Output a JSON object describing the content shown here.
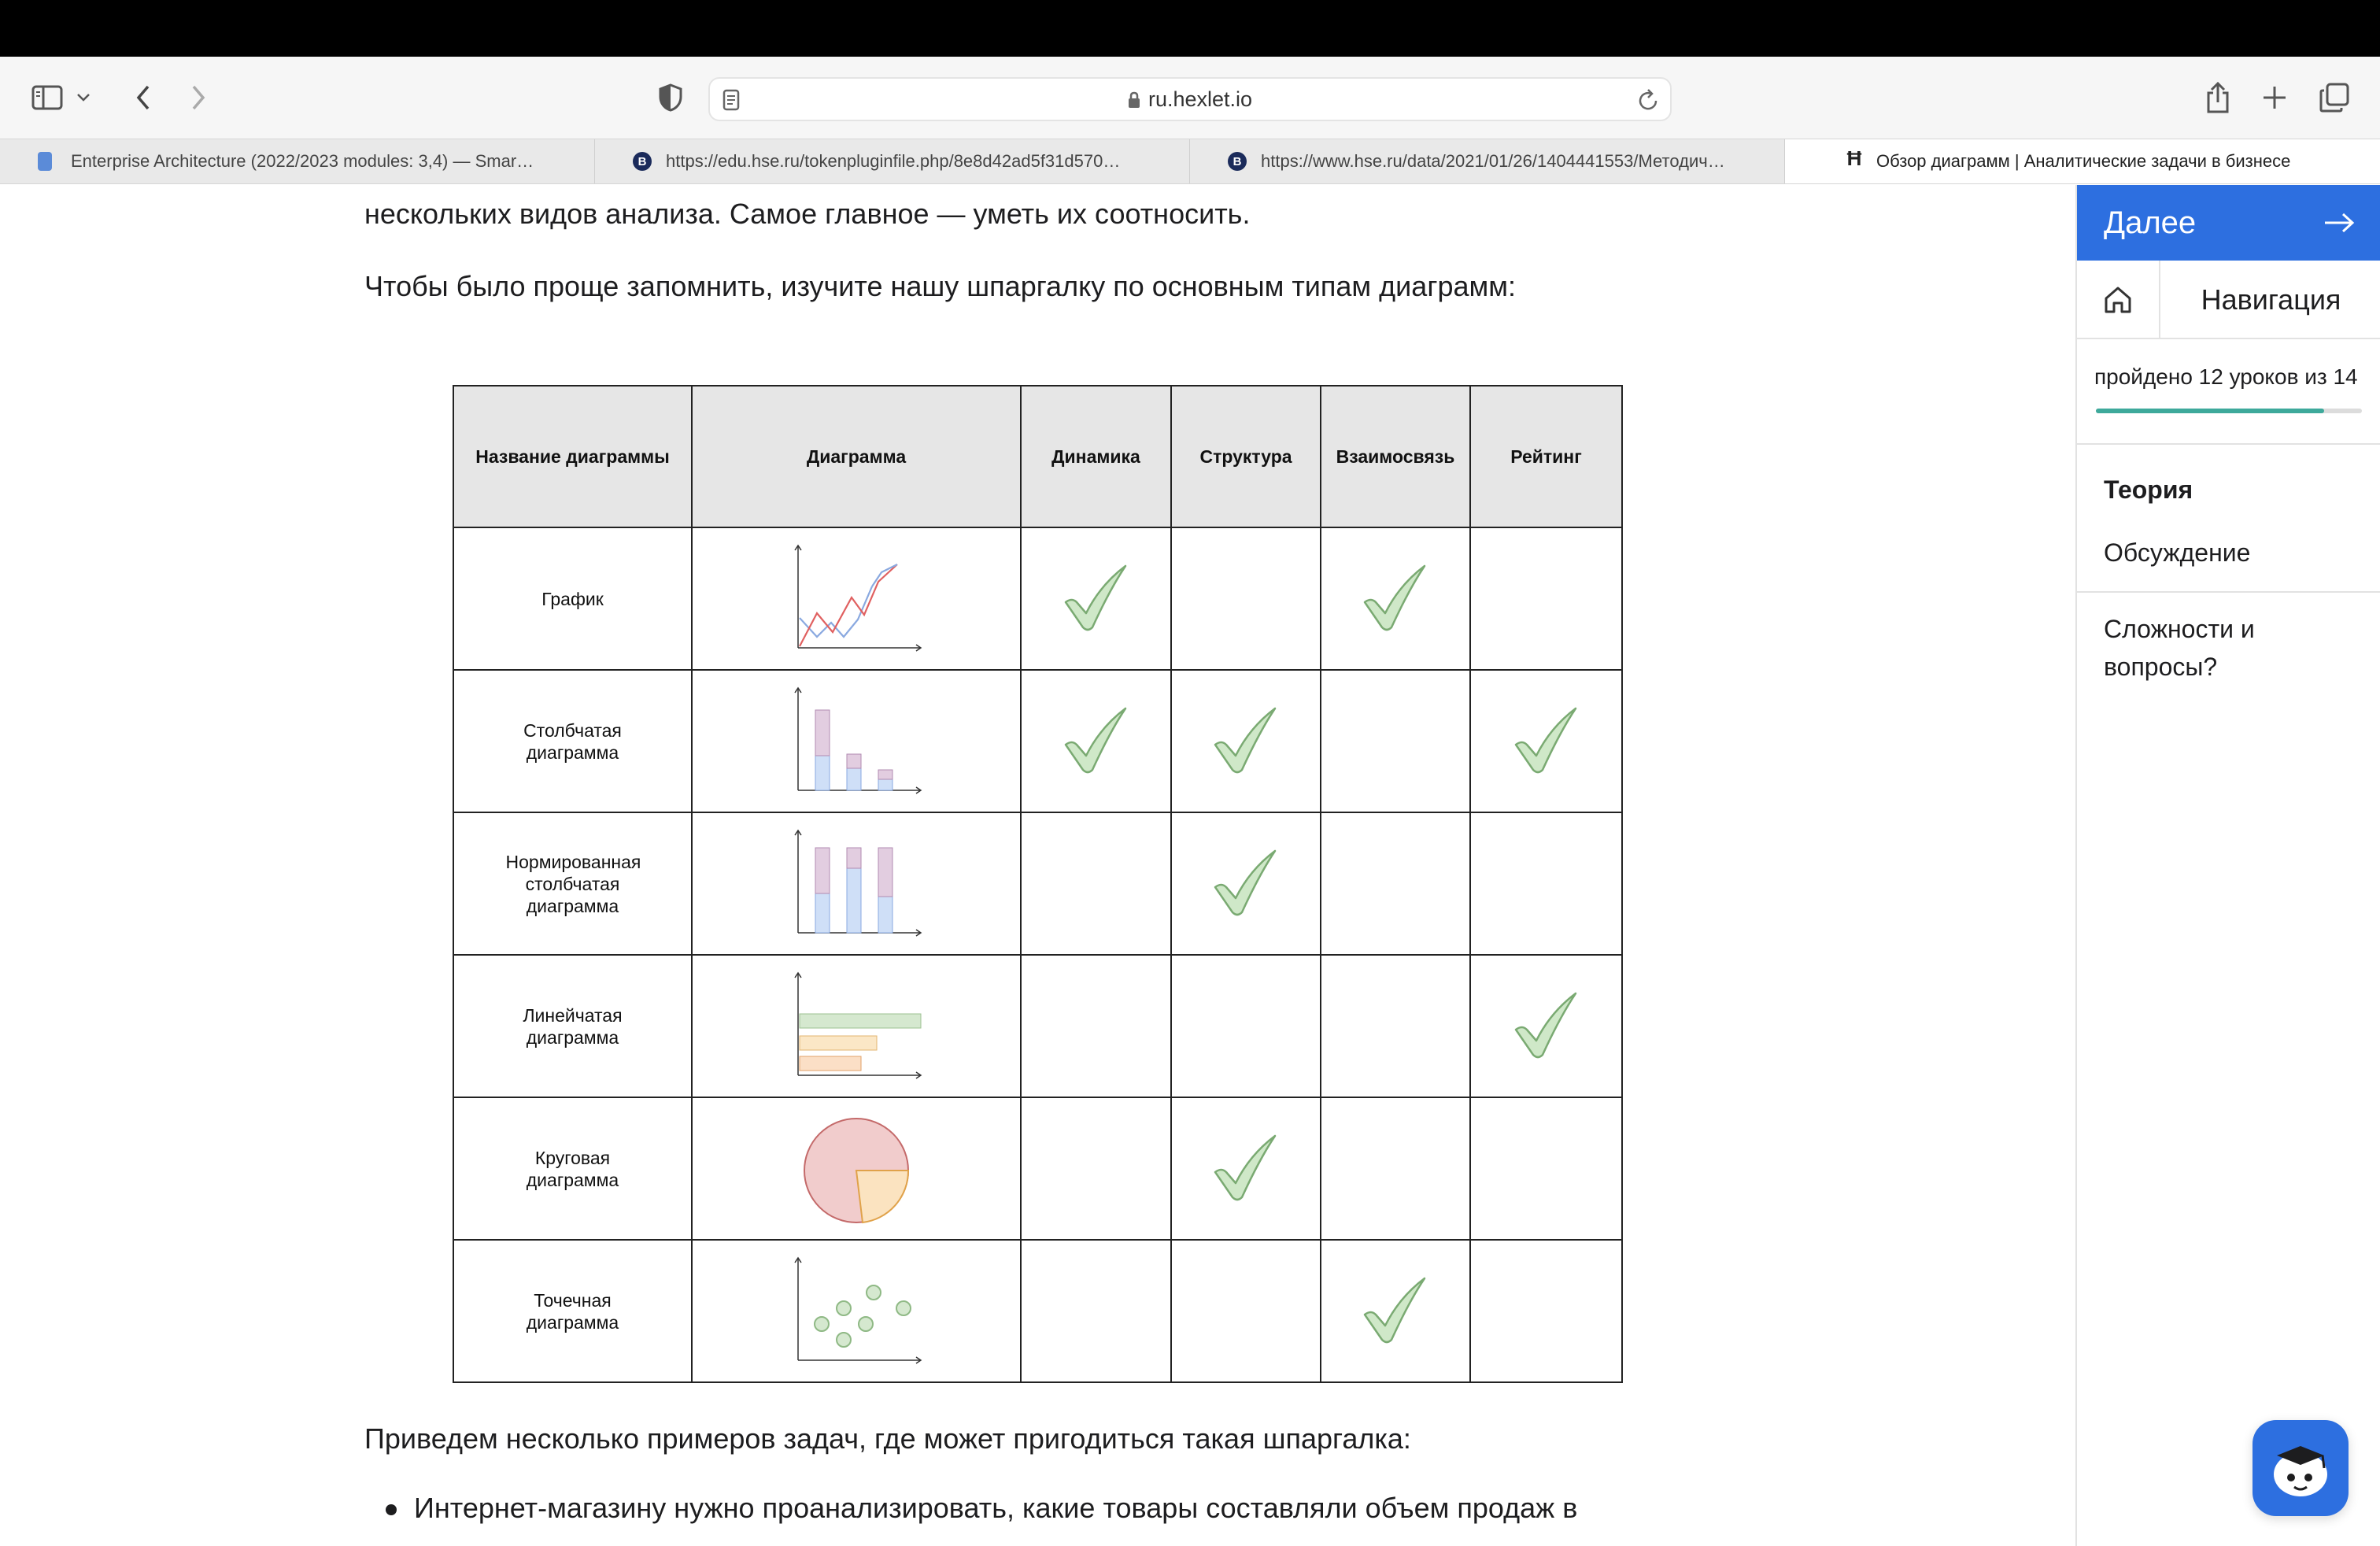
{
  "browser": {
    "url": "ru.hexlet.io",
    "tabs": [
      {
        "title": "Enterprise Architecture (2022/2023 modules: 3,4) — Smar…",
        "icon": "smartlms-icon",
        "active": false
      },
      {
        "title": "https://edu.hse.ru/tokenpluginfile.php/8e8d42ad5f31d570…",
        "icon": "hse-icon",
        "active": false
      },
      {
        "title": "https://www.hse.ru/data/2021/01/26/1404441553/Методич…",
        "icon": "hse-icon",
        "active": false
      },
      {
        "title": "Обзор диаграмм | Аналитические задачи в бизнесе",
        "icon": "hexlet-icon",
        "active": true
      }
    ]
  },
  "content": {
    "intro_line1": "нескольких видов анализа. Самое главное — уметь их соотносить.",
    "intro_line2": "Чтобы было проще запомнить, изучите нашу шпаргалку по основным типам диаграмм:",
    "table": {
      "headers": [
        "Название диаграммы",
        "Диаграмма",
        "Динамика",
        "Структура",
        "Взаимосвязь",
        "Рейтинг"
      ],
      "rows": [
        {
          "name": "График",
          "icon": "line-chart-icon",
          "checks": [
            true,
            false,
            true,
            false
          ]
        },
        {
          "name": "Столбчатая диаграмма",
          "icon": "bar-chart-icon",
          "checks": [
            true,
            true,
            false,
            true
          ]
        },
        {
          "name": "Нормированная столбчатая диаграмма",
          "icon": "stacked-bar-chart-icon",
          "checks": [
            false,
            true,
            false,
            false
          ]
        },
        {
          "name": "Линейчатая диаграмма",
          "icon": "horizontal-bar-chart-icon",
          "checks": [
            false,
            false,
            false,
            true
          ]
        },
        {
          "name": "Круговая диаграмма",
          "icon": "pie-chart-icon",
          "checks": [
            false,
            true,
            false,
            false
          ]
        },
        {
          "name": "Точечная диаграмма",
          "icon": "scatter-chart-icon",
          "checks": [
            false,
            false,
            true,
            false
          ]
        }
      ]
    },
    "examples_intro": "Приведем несколько примеров задач, где может пригодиться такая шпаргалка:",
    "examples": [
      "Интернет-магазину нужно проанализировать, какие товары составляли объем продаж в"
    ]
  },
  "sidebar": {
    "next_label": "Далее",
    "nav_label": "Навигация",
    "progress_text": "пройдено 12 уроков из 14",
    "progress_fraction": 0.857,
    "links": [
      "Теория",
      "Обсуждение",
      "Сложности и вопросы?"
    ]
  },
  "colors": {
    "accent": "#2d6fe0",
    "progress": "#3ea99b",
    "check": "#cfe8c8",
    "check_stroke": "#7aaa72"
  }
}
